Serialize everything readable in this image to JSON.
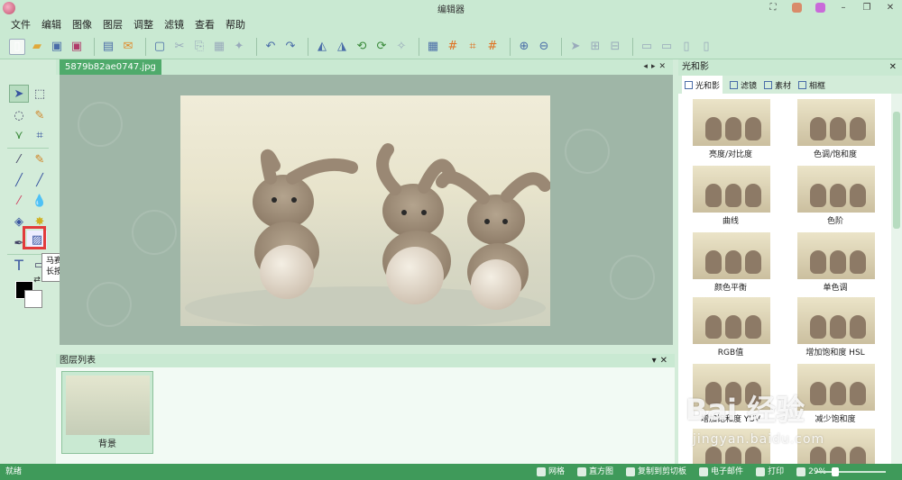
{
  "window": {
    "title": "编辑器",
    "colors": {
      "chrome": "#c9e9d2",
      "accent": "#4faa6b",
      "status": "#3f9a5a",
      "highlight": "#e23b3b"
    }
  },
  "menu": [
    "文件",
    "编辑",
    "图像",
    "图层",
    "调整",
    "滤镜",
    "查看",
    "帮助"
  ],
  "document": {
    "tab_label": "5879b82ae0747.jpg"
  },
  "tooltip": {
    "title": "马赛克刷子",
    "desc": "长按，工具组"
  },
  "layers": {
    "panel_title": "图层列表",
    "items": [
      {
        "label": "背景"
      }
    ]
  },
  "right_panel": {
    "title": "光和影",
    "tabs": [
      "光和影",
      "滤镜",
      "素材",
      "相框"
    ],
    "effects": [
      "亮度/对比度",
      "色调/饱和度",
      "曲线",
      "色阶",
      "颜色平衡",
      "单色调",
      "RGB值",
      "增加饱和度 HSL",
      "增加饱和度 YUV",
      "减少饱和度",
      "",
      ""
    ]
  },
  "status": {
    "ready": "就绪",
    "grid": "网格",
    "histogram": "直方图",
    "copy_clipboard": "复制到剪切板",
    "email": "电子邮件",
    "print": "打印",
    "zoom": "29%"
  },
  "watermark": {
    "logo": "Bai 经验",
    "url": "jingyan.baidu.com"
  }
}
